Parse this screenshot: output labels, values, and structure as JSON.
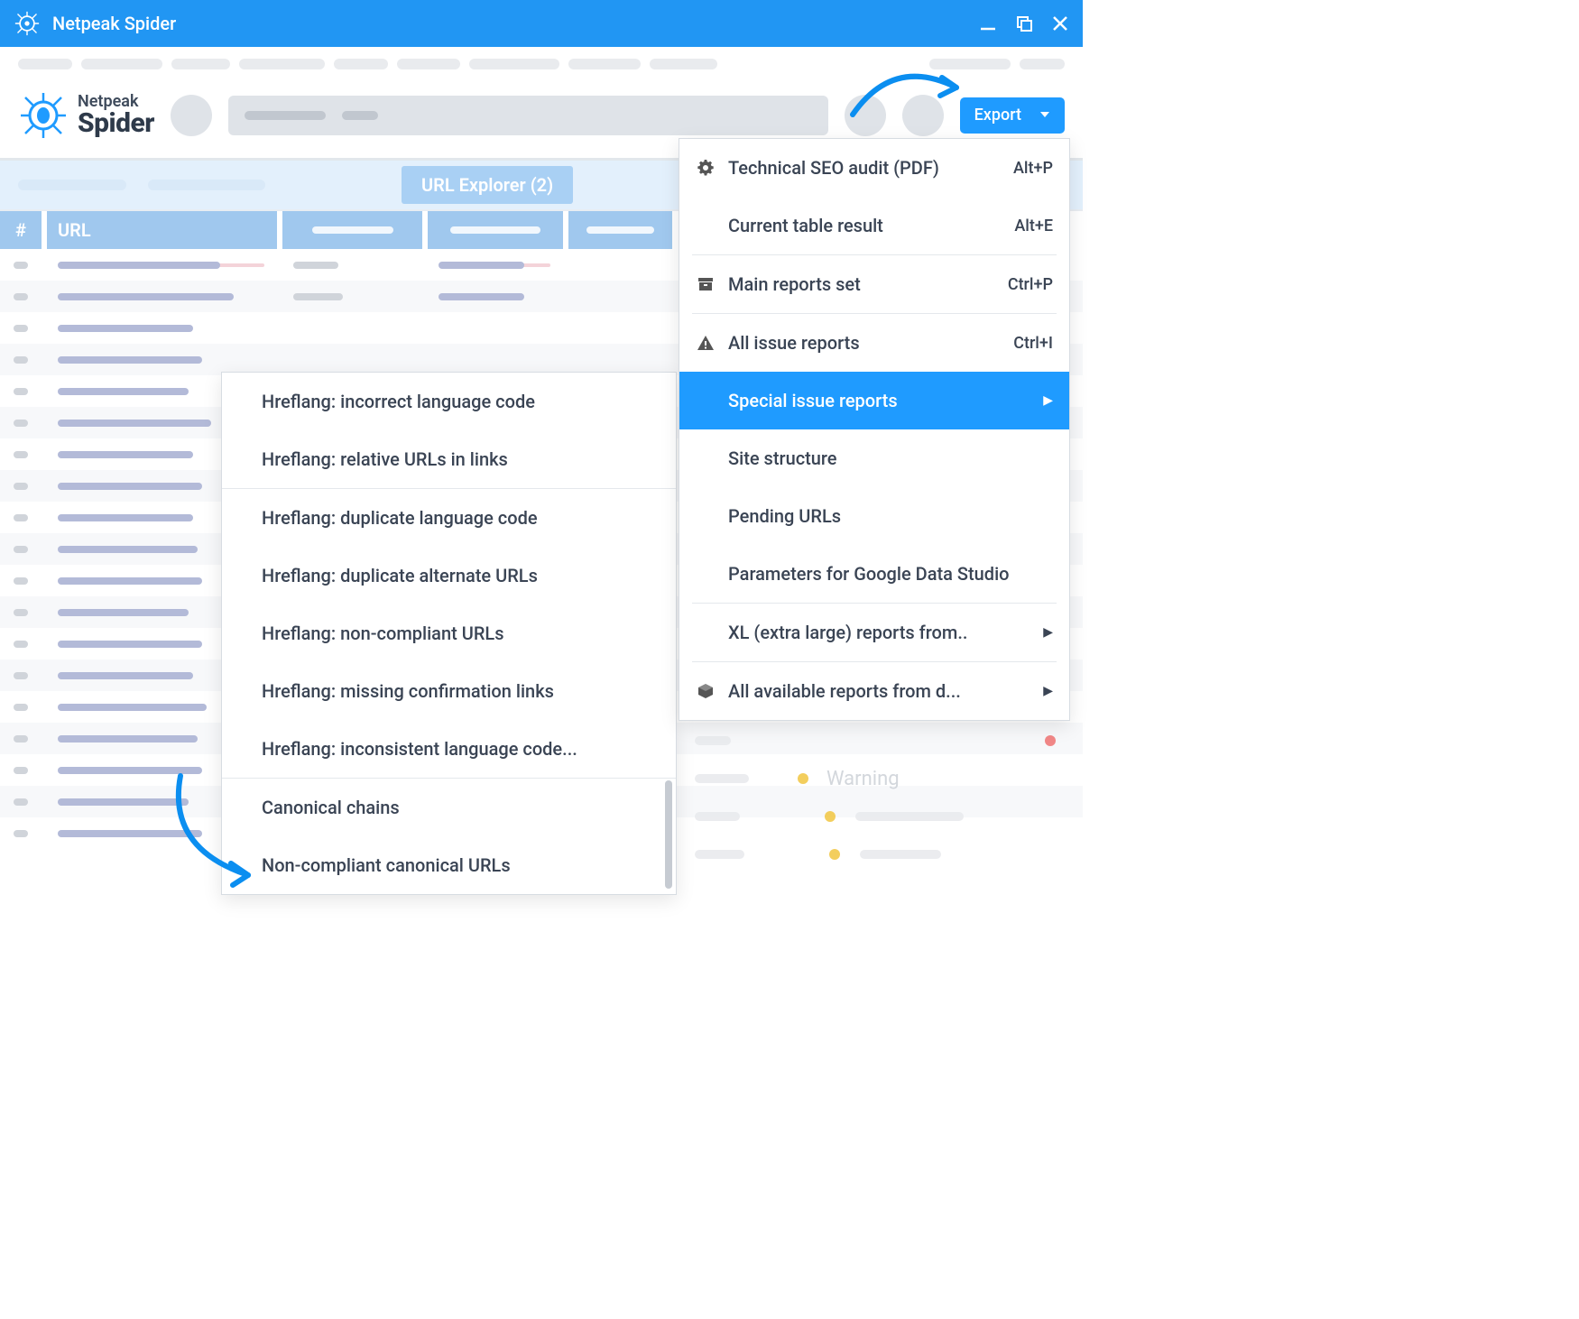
{
  "window": {
    "title": "Netpeak Spider"
  },
  "brand": {
    "line1": "Netpeak",
    "line2": "Spider"
  },
  "toolbar": {
    "export_label": "Export"
  },
  "tabs": {
    "active_label": "URL Explorer (2)"
  },
  "table": {
    "col_num": "#",
    "col_url": "URL"
  },
  "export_menu": {
    "items": [
      {
        "icon": "gear",
        "label": "Technical SEO audit (PDF)",
        "shortcut": "Alt+P",
        "arrow": false,
        "highlighted": false
      },
      {
        "icon": "",
        "label": "Current table result",
        "shortcut": "Alt+E",
        "arrow": false,
        "highlighted": false
      },
      {
        "sep": true
      },
      {
        "icon": "archive",
        "label": "Main reports set",
        "shortcut": "Ctrl+P",
        "arrow": false,
        "highlighted": false
      },
      {
        "sep": true
      },
      {
        "icon": "warning",
        "label": "All issue reports",
        "shortcut": "Ctrl+I",
        "arrow": false,
        "highlighted": false
      },
      {
        "icon": "",
        "label": "Special issue reports",
        "shortcut": "",
        "arrow": true,
        "highlighted": true
      },
      {
        "icon": "",
        "label": "Site structure",
        "shortcut": "",
        "arrow": false,
        "highlighted": false
      },
      {
        "icon": "",
        "label": "Pending URLs",
        "shortcut": "",
        "arrow": false,
        "highlighted": false
      },
      {
        "icon": "",
        "label": "Parameters for Google Data Studio",
        "shortcut": "",
        "arrow": false,
        "highlighted": false
      },
      {
        "sep": true
      },
      {
        "icon": "",
        "label": "XL (extra large) reports from..",
        "shortcut": "",
        "arrow": true,
        "highlighted": false
      },
      {
        "sep": true
      },
      {
        "icon": "cube",
        "label": "All available reports from d...",
        "shortcut": "",
        "arrow": true,
        "highlighted": false
      }
    ]
  },
  "submenu": {
    "items": [
      "Hreflang: incorrect language code",
      "Hreflang: relative URLs in links",
      "Hreflang: duplicate language code",
      "Hreflang: duplicate alternate URLs",
      "Hreflang: non-compliant URLs",
      "Hreflang: missing confirmation links",
      "Hreflang: inconsistent language code...",
      "Canonical chains",
      "Non-compliant canonical URLs"
    ]
  },
  "right_panel": {
    "warning_label": "Warning"
  },
  "colors": {
    "brand_blue": "#1f9bff",
    "titlebar": "#2196f3"
  }
}
